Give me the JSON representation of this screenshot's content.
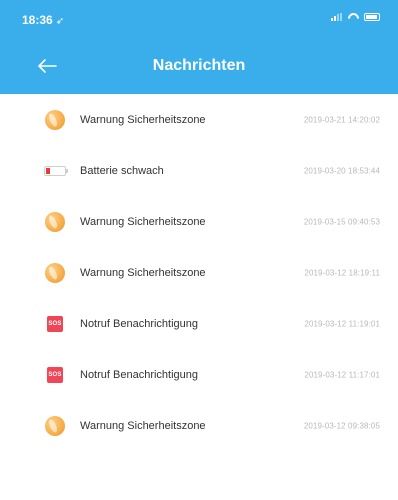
{
  "status_bar": {
    "time": "18:36",
    "location_glyph": "➶"
  },
  "nav": {
    "title": "Nachrichten",
    "back_icon": "arrow-left-icon"
  },
  "colors": {
    "header": "#3aaeea",
    "sos": "#ef4757",
    "battery_low": "#e83b3b",
    "geofence": "#f6b04e",
    "date_text": "#b9b9b9"
  },
  "messages": [
    {
      "icon": "geofence-icon",
      "title": "Warnung Sicherheitszone",
      "date": "2019-03-21 14:20:02"
    },
    {
      "icon": "battery-low-icon",
      "title": "Batterie schwach",
      "date": "2019-03-20 18:53:44"
    },
    {
      "icon": "geofence-icon",
      "title": "Warnung Sicherheitszone",
      "date": "2019-03-15 09:40:53"
    },
    {
      "icon": "geofence-icon",
      "title": "Warnung Sicherheitszone",
      "date": "2019-03-12 18:19:11"
    },
    {
      "icon": "sos-icon",
      "icon_text": "SOS",
      "title": "Notruf Benachrichtigung",
      "date": "2019-03-12 11:19:01"
    },
    {
      "icon": "sos-icon",
      "icon_text": "SOS",
      "title": "Notruf Benachrichtigung",
      "date": "2019-03-12 11:17:01"
    },
    {
      "icon": "geofence-icon",
      "title": "Warnung Sicherheitszone",
      "date": "2019-03-12 09:38:05"
    }
  ]
}
